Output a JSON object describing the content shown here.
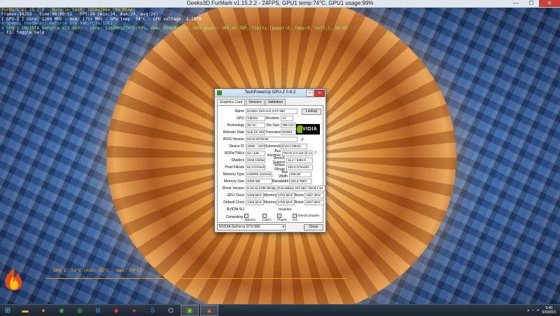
{
  "window": {
    "title": "Geeks3D FurMark v1.15.2.2 - 24FPS, GPU1 temp:74°C, GPU1 usage:99%",
    "min": "—",
    "max": "☐",
    "close": "✕"
  },
  "osd": {
    "lines": [
      {
        "text": "FurMark v1.15.2.2 - Burn-in test, 1920x1080 (8X MSAA)",
        "cls": "y"
      },
      {
        "text": "Frames:14253 - time:00:09:52 - FPS:24 (min:24, max:24, avg:24)",
        "cls": ""
      },
      {
        "text": "[ GPU-Z ] core: 1266 MHz - mem: 1753 MHz - GPU temp: 74°C - GPU voltage: 1.1870",
        "cls": ""
      },
      {
        "text": "> OpenGL renderer: GeForce GTX 980/PCIe/SSE2",
        "cls": "c"
      },
      {
        "text": "> GPU 1 (NVIDIA GeForce GTX 980) - core: 1266MHz/74°C/99%, mem: 3505MHz/5%, GPU power: 103.3% TDP, limits:[power:0, temp:0, volt:1, OV:0]",
        "cls": "g"
      },
      {
        "text": "- F1: toggle help",
        "cls": ""
      }
    ]
  },
  "graph": {
    "label": "GPU 1: 74°C (min: 55°C - max: 74°C)"
  },
  "gpuz": {
    "title": "TechPowerUp GPU-Z 0.8.2",
    "tabs": [
      "Graphics Card",
      "Sensors",
      "Validation"
    ],
    "lookup": "Lookup",
    "nvidia": "NVIDIA",
    "name_label": "Name",
    "name": "NVIDIA GeForce GTX 980",
    "gpu_label": "GPU",
    "gpu": "GM204",
    "revision_label": "Revision",
    "revision": "A1",
    "technology_label": "Technology",
    "technology": "28 nm",
    "die_size_label": "Die Size",
    "die_size": "398 mm²",
    "release_date_label": "Release Date",
    "release_date": "Sep 19, 2014",
    "transistors_label": "Transistors",
    "transistors": "5200M",
    "bios_label": "BIOS Version",
    "bios": "84.04.2F.00.80",
    "device_id_label": "Device ID",
    "device_id": "10DE - 13C0",
    "subvendor_label": "Subvendor",
    "subvendor": "EVGA (3842)",
    "rops_label": "ROPs/TMUs",
    "rops": "64 / 128",
    "bus_label": "Bus Interface",
    "bus": "PCI-E 3.0 x16 @ x16 3.0",
    "bus_help": "?",
    "shaders_label": "Shaders",
    "shaders": "2048 Unified",
    "dx_label": "DirectX Support",
    "dx": "11.2 / SM5.0",
    "pixel_label": "Pixel Fillrate",
    "pixel": "81.0 GPixel/s",
    "texture_label": "Texture Fillrate",
    "texture": "162.0 GTexel/s",
    "memtype_label": "Memory Type",
    "memtype": "GDDR5 (Samsung)",
    "buswidth_label": "Bus Width",
    "buswidth": "256 Bit",
    "memsize_label": "Memory Size",
    "memsize": "4096 MB",
    "bandwidth_label": "Bandwidth",
    "bandwidth": "224.4 GB/s",
    "driver_label": "Driver Version",
    "driver": "9.18.13.4788 WHQL (ForceWare 347.88) / Win8.1 64",
    "gpuclock_label": "GPU Clock",
    "gpuclock": "1266 MHz",
    "memory_label": "Memory",
    "mem_clock": "1753 MHz",
    "boost_label": "Boost",
    "boost": "1367 MHz",
    "default_label": "Default Clock",
    "default_clock": "1266 MHz",
    "default_mem": "1753 MHz",
    "default_boost": "1367 MHz",
    "sli_label": "NVIDIA SLI",
    "sli": "Disabled",
    "computing_label": "Computing",
    "compute": [
      "OpenCL",
      "CUDA",
      "PhysX",
      "DirectCompute 5.0"
    ],
    "selected_gpu": "NVIDIA GeForce GTX 980",
    "close": "Close"
  },
  "taskbar": {
    "icons": [
      "start-icon",
      "folder-icon",
      "firefox-icon",
      "chrome-icon",
      "chat-icon",
      "windows-icon",
      "app-icon",
      "lastfm-icon",
      "skype-icon",
      "network-icon",
      "gpuz-icon",
      "furmark-icon"
    ],
    "time": "9:40",
    "date": "6/5/2015"
  }
}
